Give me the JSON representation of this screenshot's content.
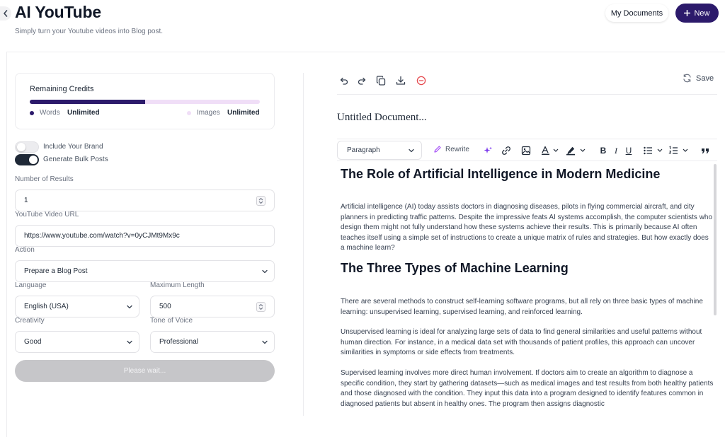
{
  "header": {
    "title": "AI YouTube",
    "subtitle": "Simply turn your Youtube videos into Blog post.",
    "my_documents": "My Documents",
    "new_label": "New"
  },
  "credits": {
    "title": "Remaining Credits",
    "words_fraction": 0.5,
    "words_label": "Words",
    "words_value": "Unlimited",
    "images_label": "Images",
    "images_value": "Unlimited",
    "colors": {
      "fill": "#2c1a6b",
      "track": "#f0def7"
    }
  },
  "toggles": {
    "brand": {
      "label": "Include Your Brand",
      "on": false
    },
    "bulk": {
      "label": "Generate Bulk Posts",
      "on": true
    }
  },
  "form": {
    "results_label": "Number of Results",
    "results_value": "1",
    "url_label": "YouTube Video URL",
    "url_value": "https://www.youtube.com/watch?v=0yCJMt9Mx9c",
    "action_label": "Action",
    "action_value": "Prepare a Blog Post",
    "language_label": "Language",
    "language_value": "English (USA)",
    "maxlen_label": "Maximum Length",
    "maxlen_value": "500",
    "creativity_label": "Creativity",
    "creativity_value": "Good",
    "tone_label": "Tone of Voice",
    "tone_value": "Professional",
    "submit_label": "Please wait..."
  },
  "editor": {
    "save_label": "Save",
    "doc_title": "Untitled Document...",
    "paragraph_select": "Paragraph",
    "rewrite_label": "Rewrite",
    "content": {
      "h1": "The Role of Artificial Intelligence in Modern Medicine",
      "p1": "Artificial intelligence (AI) today assists doctors in diagnosing diseases, pilots in flying commercial aircraft, and city planners in predicting traffic patterns. Despite the impressive feats AI systems accomplish, the computer scientists who design them might not fully understand how these systems achieve their results. This is primarily because AI often teaches itself using a simple set of instructions to create a unique matrix of rules and strategies. But how exactly does a machine learn?",
      "h2": "The Three Types of Machine Learning",
      "p2": "There are several methods to construct self-learning software programs, but all rely on three basic types of machine learning: unsupervised learning, supervised learning, and reinforced learning.",
      "p3": "Unsupervised learning is ideal for analyzing large sets of data to find general similarities and useful patterns without human direction. For instance, in a medical data set with thousands of patient profiles, this approach can uncover similarities in symptoms or side effects from treatments.",
      "p4": "Supervised learning involves more direct human involvement. If doctors aim to create an algorithm to diagnose a specific condition, they start by gathering datasets—such as medical images and test results from both healthy patients and those diagnosed with the condition. They input this data into a program designed to identify features common in diagnosed patients but absent in healthy ones. The program then assigns diagnostic"
    }
  }
}
